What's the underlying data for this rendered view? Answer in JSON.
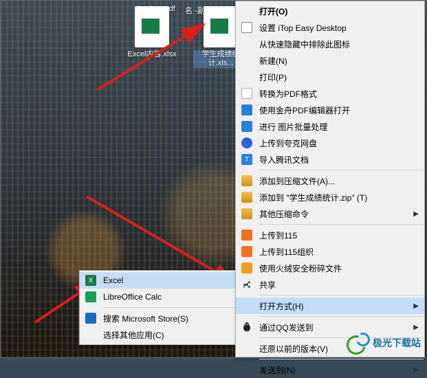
{
  "desktop": {
    "pdf_label": "backup.pdf",
    "sub_label": "名 -副本 ...",
    "files": [
      {
        "label": "Excel内容.xlsx",
        "selected": false
      },
      {
        "label": "学生成绩统计.xls...",
        "selected": true
      }
    ]
  },
  "mainmenu": {
    "open": "打开(O)",
    "itop": "设置 iTop Easy Desktop",
    "exclude": "从快速隐藏中排除此图标",
    "new": "新建(N)",
    "print": "打印(P)",
    "topdf": "转换为PDF格式",
    "jinzhou": "使用金舟PDF编辑器打开",
    "batch": "进行 图片批量处理",
    "kuake": "上传到夸克网盘",
    "tencent": "导入腾讯文档",
    "addzip": "添加到压缩文件(A)...",
    "addtozip": "添加到 \"学生成绩统计.zip\" (T)",
    "otherzip": "其他压缩命令",
    "115": "上传到115",
    "115org": "上传到115组织",
    "huorong": "使用火绒安全粉碎文件",
    "share": "共享",
    "openwith": "打开方式(H)",
    "qq": "通过QQ发送到",
    "prev": "还原以前的版本(V)",
    "sendto": "发送到(N)"
  },
  "submenu": {
    "excel": "Excel",
    "libre": "LibreOffice Calc",
    "store": "搜索 Microsoft Store(S)",
    "other": "选择其他应用(C)"
  },
  "logo": {
    "text": "极光下载站"
  },
  "colors": {
    "highlight": "#c5ddf7",
    "arrow": "#d81e1e",
    "excel": "#1a7a44"
  }
}
